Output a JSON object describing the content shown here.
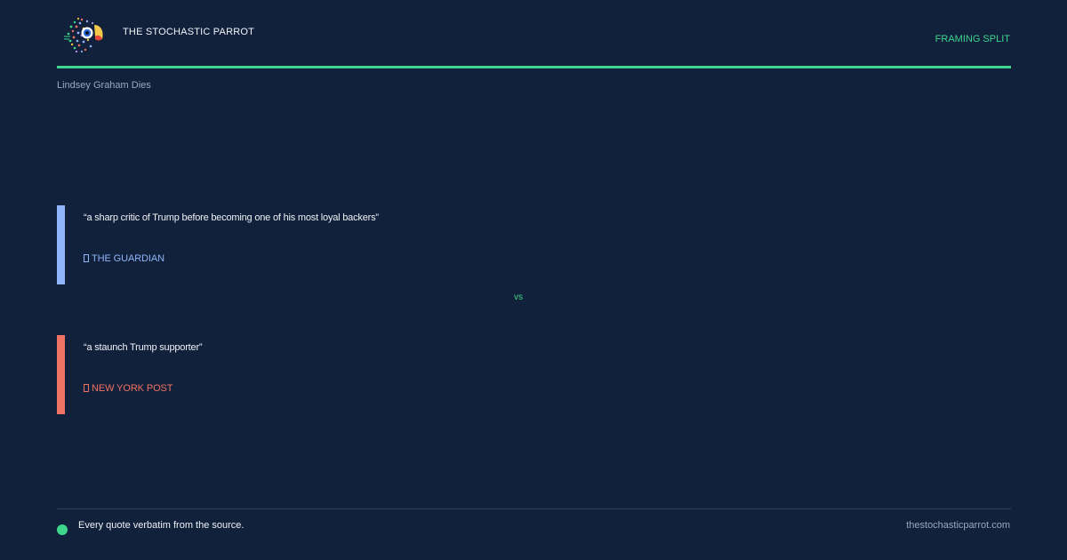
{
  "header": {
    "brand": "THE STOCHASTIC PARROT",
    "tag": "FRAMING SPLIT",
    "logo_icon": "parrot-logo-icon"
  },
  "story": {
    "title": "Lindsey Graham Dies"
  },
  "quotes": [
    {
      "text": "“a sharp critic of Trump before becoming one of his most loyal backers”",
      "source": "THE GUARDIAN",
      "color": "#8fb4f8"
    },
    {
      "text": "“a staunch Trump supporter”",
      "source": "NEW YORK POST",
      "color": "#f07263"
    }
  ],
  "separator": "vs",
  "footer": {
    "note": "Every quote verbatim from the source.",
    "site": "thestochasticparrot.com"
  },
  "colors": {
    "background": "#12213b",
    "accent": "#3dd68c"
  }
}
